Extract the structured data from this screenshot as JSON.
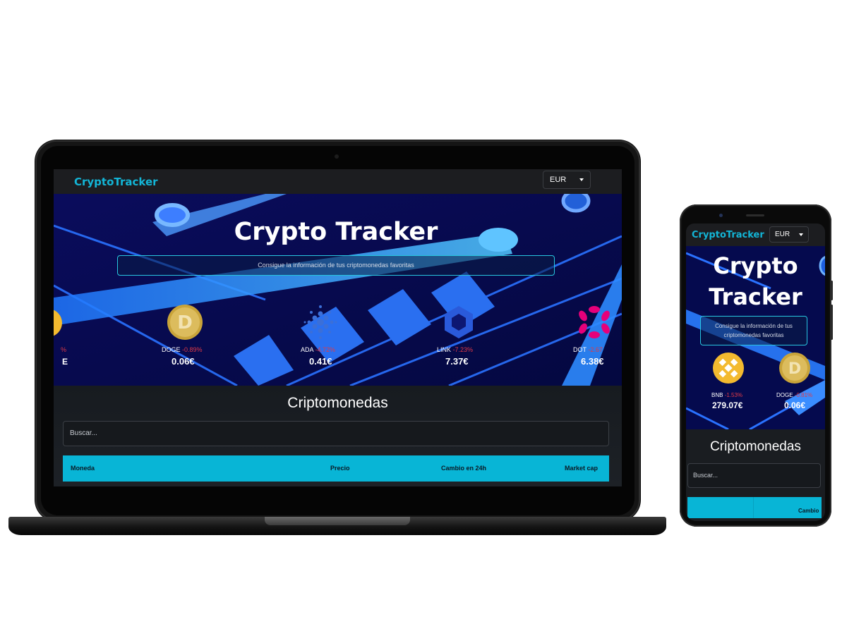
{
  "app": {
    "brand": "CryptoTracker",
    "currency": "EUR",
    "hero_title": "Crypto Tracker",
    "hero_title_line1": "Crypto",
    "hero_title_line2": "Tracker",
    "subtitle": "Consigue la información de tus criptomonedas favoritas",
    "subtitle_line1": "Consigue la información de tus",
    "subtitle_line2": "criptomonedas favoritas",
    "section_title": "Criptomonedas",
    "search_placeholder": "Buscar...",
    "columns": [
      "Moneda",
      "Precio",
      "Cambio en 24h",
      "Market cap"
    ],
    "mobile_column": "Cambio"
  },
  "laptop_coins": [
    {
      "symbol": "DOGE",
      "change": "-0.89%",
      "price": "0.06€",
      "icon": "doge-icon"
    },
    {
      "symbol": "ADA",
      "change": "-4.72%",
      "price": "0.41€",
      "icon": "cardano-icon"
    },
    {
      "symbol": "LINK",
      "change": "-7.23%",
      "price": "7.37€",
      "icon": "chainlink-icon"
    },
    {
      "symbol": "DOT",
      "change": "-2.67",
      "price": "6.38€",
      "icon": "polkadot-icon"
    }
  ],
  "laptop_partial_coin": {
    "change": "%",
    "price": "E",
    "icon": "coin-icon"
  },
  "phone_coins": [
    {
      "symbol": "BNB",
      "change": "-1.53%",
      "price": "279.07€",
      "icon": "bnb-icon"
    },
    {
      "symbol": "DOGE",
      "change": "-0.81%",
      "price": "0.06€",
      "icon": "doge-icon"
    }
  ],
  "colors": {
    "accent": "#13b5d6",
    "table_header": "#08b5d6",
    "negative": "#e03a47",
    "hero_bg": "#050a4e"
  }
}
